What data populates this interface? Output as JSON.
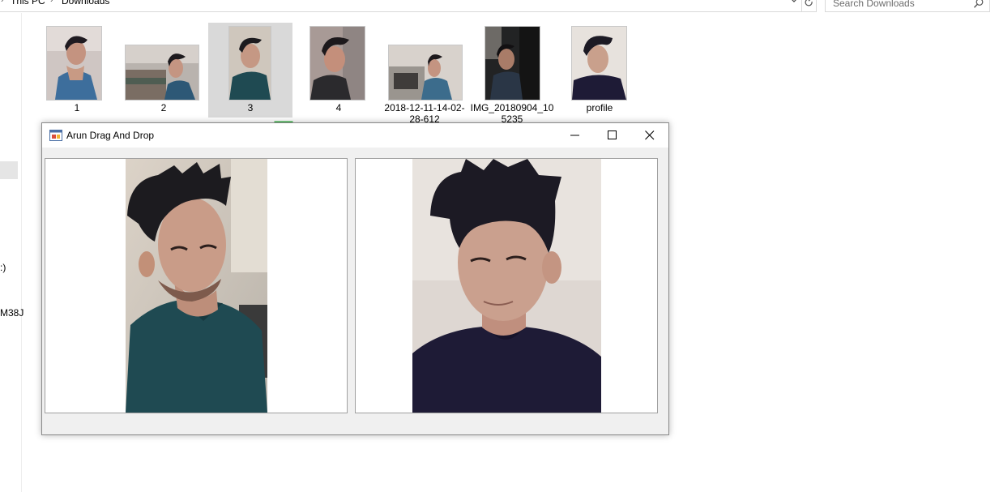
{
  "explorer": {
    "breadcrumb": [
      "This PC",
      "Downloads"
    ],
    "search_placeholder": "Search Downloads",
    "nav_fragments": [
      ":)",
      "M38J"
    ],
    "files": [
      {
        "name": "1",
        "selected": false
      },
      {
        "name": "2",
        "selected": false
      },
      {
        "name": "3",
        "selected": true
      },
      {
        "name": "4",
        "selected": false
      },
      {
        "name": "2018-12-11-14-02-28-612",
        "selected": false
      },
      {
        "name": "IMG_20180904_105235",
        "selected": false
      },
      {
        "name": "profile",
        "selected": false
      }
    ]
  },
  "window": {
    "title": "Arun Drag And Drop",
    "icon": "winforms-app-icon",
    "buttons": [
      "minimize-icon",
      "maximize-icon",
      "close-icon"
    ]
  },
  "arrow": {
    "color": "#3cb54a",
    "direction": "down"
  },
  "colors": {
    "accent_selection": "#d9d9d9",
    "window_background": "#f0f0f0",
    "shirt_teal": "#1f4a52",
    "shirt_navy": "#1e1b36"
  }
}
